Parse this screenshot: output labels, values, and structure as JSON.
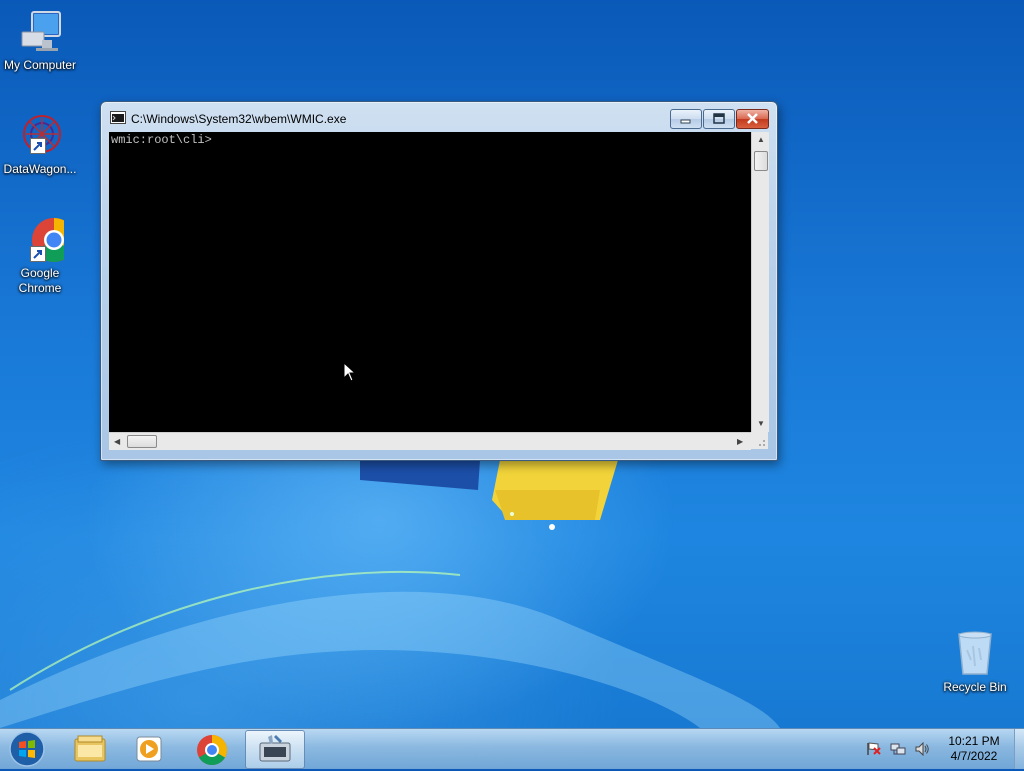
{
  "desktop": {
    "icons": [
      {
        "label": "My Computer",
        "icon": "computer-icon"
      },
      {
        "label": "DataWagon...",
        "icon": "datawagon-icon"
      },
      {
        "label_line1": "Google",
        "label_line2": "Chrome",
        "icon": "chrome-icon"
      },
      {
        "label": "Recycle Bin",
        "icon": "recycle-bin-icon"
      }
    ]
  },
  "window": {
    "title": "C:\\Windows\\System32\\wbem\\WMIC.exe",
    "console_lines": [
      "wmic:root\\cli>"
    ],
    "background_color": "#000000",
    "text_color": "#c0c0c0"
  },
  "taskbar": {
    "items": [
      {
        "icon": "windows-explorer-icon"
      },
      {
        "icon": "media-player-icon"
      },
      {
        "icon": "chrome-icon"
      },
      {
        "icon": "wmic-console-icon",
        "active": true
      }
    ],
    "clock": {
      "time": "10:21 PM",
      "date": "4/7/2022"
    }
  }
}
